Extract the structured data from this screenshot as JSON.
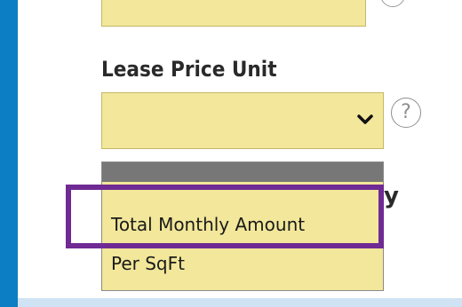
{
  "form": {
    "lease_price_unit_label": "Lease Price Unit",
    "help_symbol": "?",
    "partial_label_right": "y"
  },
  "dropdown": {
    "options": [
      "Total Monthly Amount",
      "Per SqFt"
    ],
    "highlighted_option": "Total Monthly Amount"
  },
  "colors": {
    "field_bg": "#f2e79a",
    "highlight": "#6f2a93",
    "frame": "#0b7ec4"
  },
  "icons": {
    "select_arrow": "chevron-down-icon",
    "help": "question-circle-icon"
  }
}
